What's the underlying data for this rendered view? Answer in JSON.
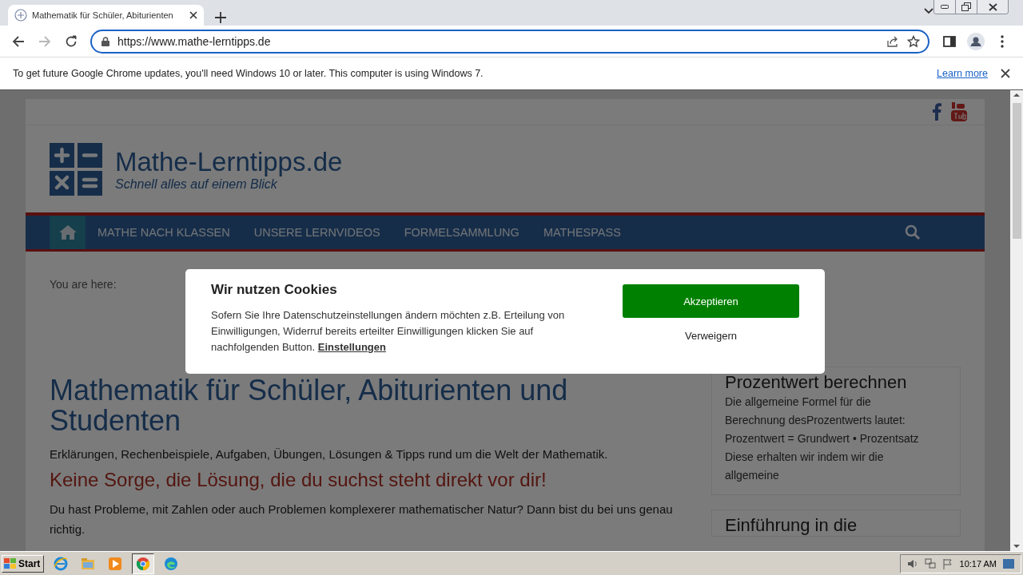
{
  "browser": {
    "tabs": [
      {
        "title": "Mathematik für Schüler, Abiturienten",
        "selected": true
      }
    ],
    "address": "https://www.mathe-lerntipps.de",
    "forward": {
      "disabled": true
    }
  },
  "infobar": {
    "message": "To get future Google Chrome updates, you'll need Windows 10 or later. This computer is using Windows 7.",
    "link": "Learn more"
  },
  "site": {
    "title": "Mathe-Lerntipps.de",
    "tagline": "Schnell alles auf einem Blick",
    "nav": [
      {
        "kind": "home",
        "selected": true
      },
      {
        "kind": "link",
        "label": "MATHE NACH KLASSEN",
        "selected": false
      },
      {
        "kind": "link",
        "label": "UNSERE LERNVIDEOS",
        "selected": false
      },
      {
        "kind": "link",
        "label": "FORMELSAMMLUNG",
        "selected": false
      },
      {
        "kind": "link",
        "label": "MATHESPASS",
        "selected": false
      }
    ],
    "breadcrumb": "You are here:",
    "heading": "Mathematik für Schüler, Abiturienten und Studenten",
    "intro": "Erklärungen, Rechenbeispiele, Aufgaben, Übungen, Lösungen & Tipps rund um die Welt der Mathematik.",
    "subheading": "Keine Sorge, die Lösung, die du suchst steht direkt vor dir!",
    "paragraph": "Du hast Probleme, mit Zahlen oder auch Problemen komplexerer mathematischer Natur? Dann bist du bei uns genau richtig.",
    "sidebar": [
      {
        "title": "Prozentwert berechnen",
        "lines": [
          "Die allgemeine Formel für die Berechnung desProzentwerts lautet:",
          "Prozentwert = Grundwert • Prozentsatz",
          "Diese erhalten wir indem wir die allgemeine"
        ]
      },
      {
        "title": "Einführung in die"
      }
    ]
  },
  "cookie_dialog": {
    "title": "Wir nutzen Cookies",
    "text": "Sofern Sie Ihre Datenschutzeinstellungen ändern möchten z.B. Erteilung von Einwilligungen, Widerruf bereits erteilter Einwilligungen klicken Sie auf nachfolgenden Button.",
    "link": "Einstellungen",
    "accept": "Akzeptieren",
    "decline": "Verweigern"
  },
  "taskbar": {
    "start": "Start",
    "apps": [
      {
        "kind": "ie",
        "selected": false
      },
      {
        "kind": "explorer",
        "selected": false
      },
      {
        "kind": "media",
        "selected": false
      },
      {
        "kind": "chrome",
        "selected": true
      },
      {
        "kind": "edge",
        "selected": false
      }
    ],
    "time": "10:17 AM"
  }
}
